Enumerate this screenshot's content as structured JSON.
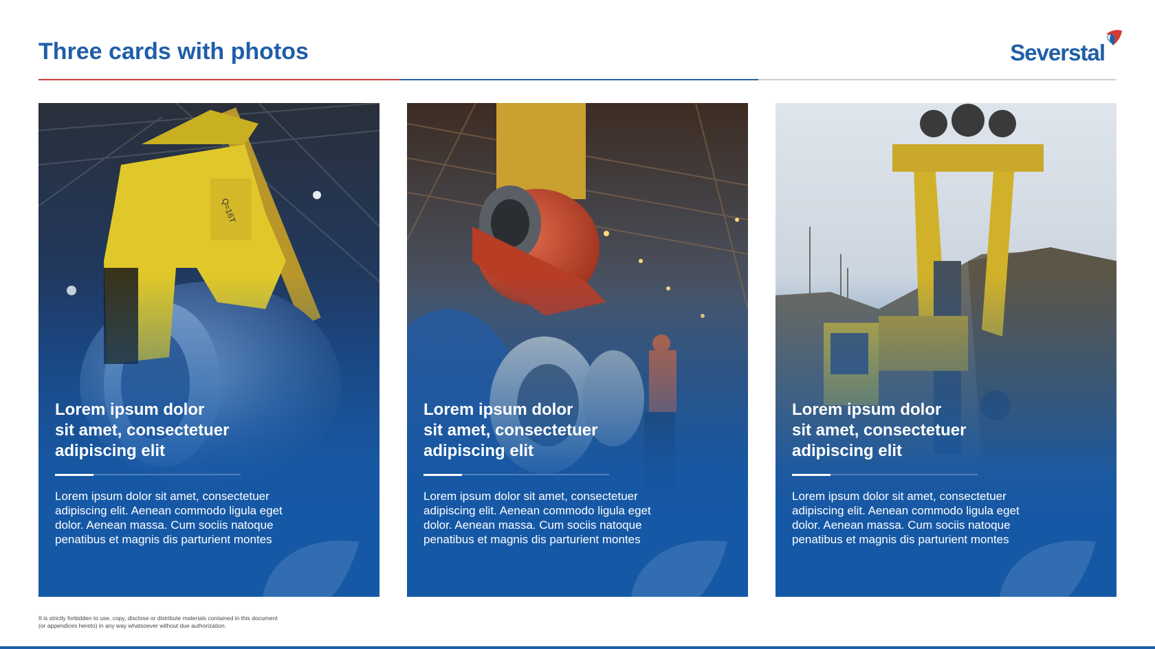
{
  "slide": {
    "title": "Three cards with photos",
    "logo_text": "Severstal",
    "footer_note": "It is strictly forbidden to use, copy, disclose or distribute materials contained in this document\n(or appendices hereto) in any way whatsoever without due authorization."
  },
  "colors": {
    "brand_blue": "#1f5ea8",
    "card_blue": "#1558a6",
    "rule_red": "#c8413c",
    "rule_blue": "#2b5ea6",
    "rule_grey": "#cfcfcf"
  },
  "cards": [
    {
      "heading": "Lorem ipsum dolor\nsit amet, consectetuer\nadipiscing elit",
      "body": "Lorem ipsum dolor sit amet, consectetuer adipiscing elit. Aenean commodo ligula eget dolor. Aenean massa. Cum sociis natoque penatibus et magnis dis parturient montes",
      "photo_icon": "crane-steel-coil-photo"
    },
    {
      "heading": "Lorem ipsum dolor\nsit amet, consectetuer\nadipiscing elit",
      "body": "Lorem ipsum dolor sit amet, consectetuer adipiscing elit. Aenean commodo ligula eget dolor. Aenean massa. Cum sociis natoque penatibus et magnis dis parturient montes",
      "photo_icon": "worker-red-coil-photo"
    },
    {
      "heading": "Lorem ipsum dolor\nsit amet, consectetuer\nadipiscing elit",
      "body": "Lorem ipsum dolor sit amet, consectetuer adipiscing elit. Aenean commodo ligula eget dolor. Aenean massa. Cum sociis natoque penatibus et magnis dis parturient montes",
      "photo_icon": "excavator-quarry-photo"
    }
  ]
}
